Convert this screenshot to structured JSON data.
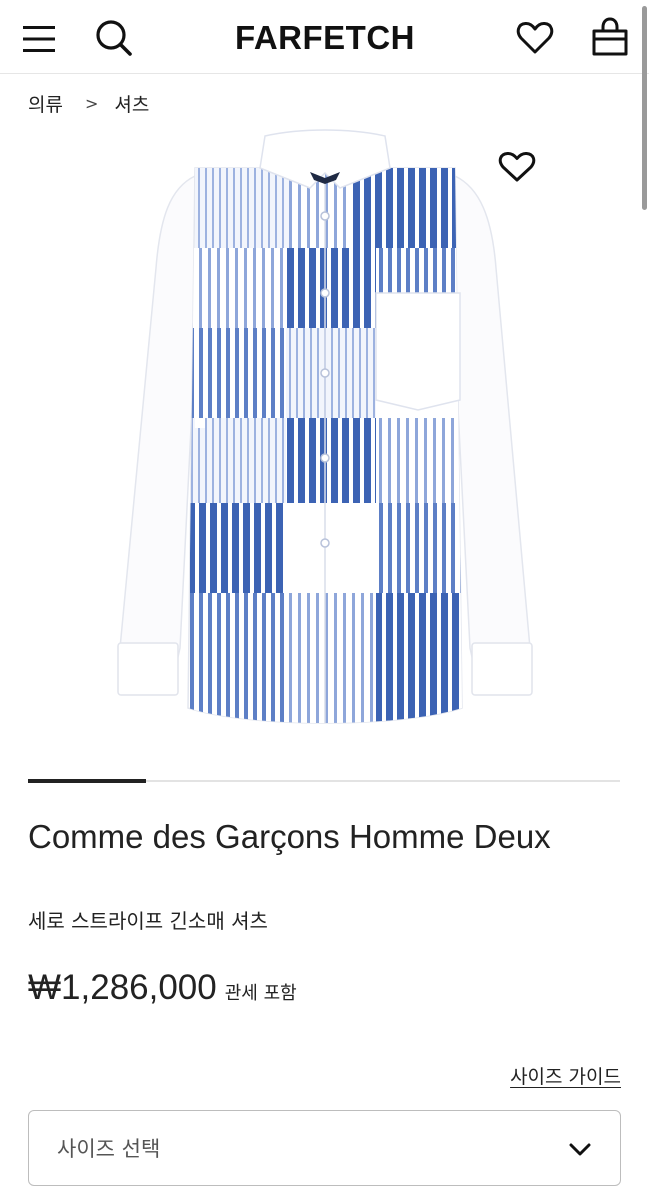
{
  "header": {
    "logo": "FARFETCH",
    "icons": [
      "menu-icon",
      "search-icon",
      "heart-icon",
      "bag-icon"
    ]
  },
  "breadcrumb": {
    "items": [
      "의류",
      "셔츠"
    ],
    "separator": ">"
  },
  "product": {
    "brand": "Comme des Garçons Homme Deux",
    "name": "세로 스트라이프 긴소매 셔츠",
    "price": "₩1,286,000",
    "price_note": "관세 포함",
    "image_icon": "shirt-image",
    "gallery": {
      "current": 1,
      "total": 5
    }
  },
  "size": {
    "guide_label": "사이즈 가이드",
    "select_placeholder": "사이즈 선택"
  },
  "colors": {
    "stripe_dark": "#3c63b4",
    "stripe_mid": "#6f8fd0",
    "stripe_light": "#b9c8ea",
    "text": "#222222"
  }
}
